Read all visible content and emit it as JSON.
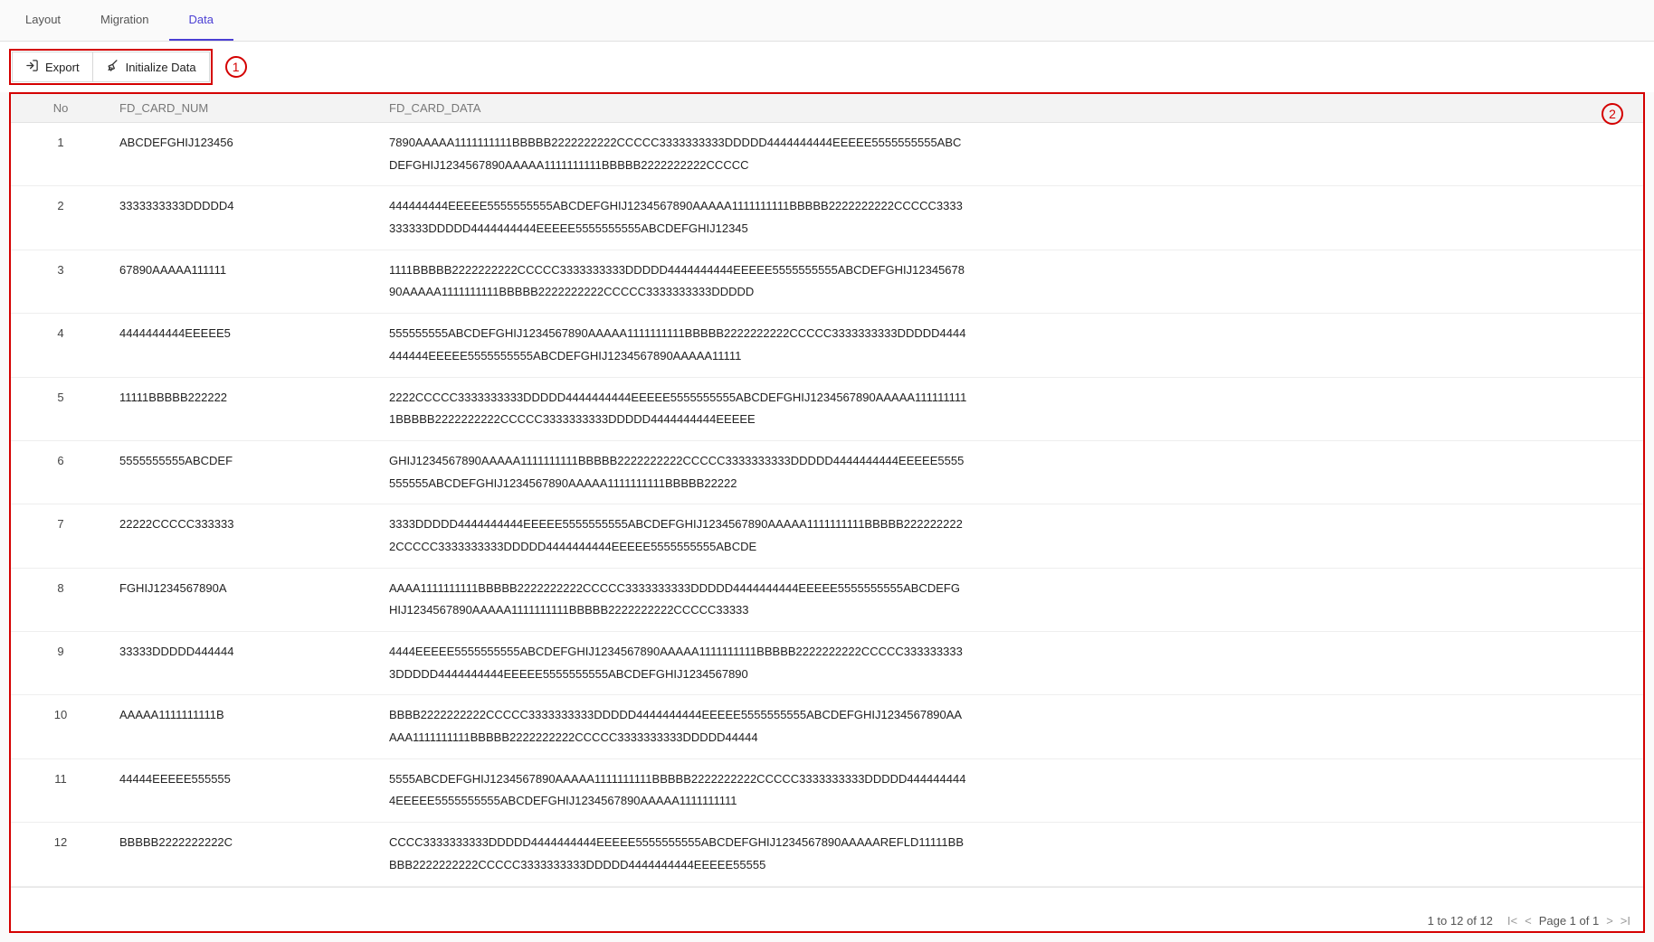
{
  "tabs": {
    "layout": "Layout",
    "migration": "Migration",
    "data": "Data",
    "active": "data"
  },
  "toolbar": {
    "export": "Export",
    "initialize": "Initialize Data"
  },
  "annotations": {
    "one": "1",
    "two": "2"
  },
  "table": {
    "headers": {
      "no": "No",
      "card_num": "FD_CARD_NUM",
      "card_data": "FD_CARD_DATA"
    },
    "rows": [
      {
        "no": "1",
        "num": "ABCDEFGHIJ123456",
        "data": "7890AAAAA1111111111BBBBB2222222222CCCCC3333333333DDDDD4444444444EEEEE5555555555ABCDEFGHIJ1234567890AAAAA1111111111BBBBB2222222222CCCCC"
      },
      {
        "no": "2",
        "num": "3333333333DDDDD4",
        "data": "444444444EEEEE5555555555ABCDEFGHIJ1234567890AAAAA1111111111BBBBB2222222222CCCCC3333333333DDDDD4444444444EEEEE5555555555ABCDEFGHIJ12345"
      },
      {
        "no": "3",
        "num": "67890AAAAA111111",
        "data": "1111BBBBB2222222222CCCCC3333333333DDDDD4444444444EEEEE5555555555ABCDEFGHIJ1234567890AAAAA1111111111BBBBB2222222222CCCCC3333333333DDDDD"
      },
      {
        "no": "4",
        "num": "4444444444EEEEE5",
        "data": "555555555ABCDEFGHIJ1234567890AAAAA1111111111BBBBB2222222222CCCCC3333333333DDDDD4444444444EEEEE5555555555ABCDEFGHIJ1234567890AAAAA11111"
      },
      {
        "no": "5",
        "num": "11111BBBBB222222",
        "data": "2222CCCCC3333333333DDDDD4444444444EEEEE5555555555ABCDEFGHIJ1234567890AAAAA1111111111BBBBB2222222222CCCCC3333333333DDDDD4444444444EEEEE"
      },
      {
        "no": "6",
        "num": "5555555555ABCDEF",
        "data": "GHIJ1234567890AAAAA1111111111BBBBB2222222222CCCCC3333333333DDDDD4444444444EEEEE5555555555ABCDEFGHIJ1234567890AAAAA1111111111BBBBB22222"
      },
      {
        "no": "7",
        "num": "22222CCCCC333333",
        "data": "3333DDDDD4444444444EEEEE5555555555ABCDEFGHIJ1234567890AAAAA1111111111BBBBB2222222222CCCCC3333333333DDDDD4444444444EEEEE5555555555ABCDE"
      },
      {
        "no": "8",
        "num": "FGHIJ1234567890A",
        "data": "AAAA1111111111BBBBB2222222222CCCCC3333333333DDDDD4444444444EEEEE5555555555ABCDEFGHIJ1234567890AAAAA1111111111BBBBB2222222222CCCCC33333"
      },
      {
        "no": "9",
        "num": "33333DDDDD444444",
        "data": "4444EEEEE5555555555ABCDEFGHIJ1234567890AAAAA1111111111BBBBB2222222222CCCCC3333333333DDDDD4444444444EEEEE5555555555ABCDEFGHIJ1234567890"
      },
      {
        "no": "10",
        "num": "AAAAA1111111111B",
        "data": "BBBB2222222222CCCCC3333333333DDDDD4444444444EEEEE5555555555ABCDEFGHIJ1234567890AAAAA1111111111BBBBB2222222222CCCCC3333333333DDDDD44444"
      },
      {
        "no": "11",
        "num": "44444EEEEE555555",
        "data": "5555ABCDEFGHIJ1234567890AAAAA1111111111BBBBB2222222222CCCCC3333333333DDDDD4444444444EEEEE5555555555ABCDEFGHIJ1234567890AAAAA1111111111"
      },
      {
        "no": "12",
        "num": "BBBBB2222222222C",
        "data": "CCCC3333333333DDDDD4444444444EEEEE5555555555ABCDEFGHIJ1234567890AAAAAREFLD11111BBBBB2222222222CCCCC3333333333DDDDD4444444444EEEEE55555"
      }
    ]
  },
  "pager": {
    "summary": "1 to 12 of 12",
    "page_text": "Page 1 of 1"
  }
}
